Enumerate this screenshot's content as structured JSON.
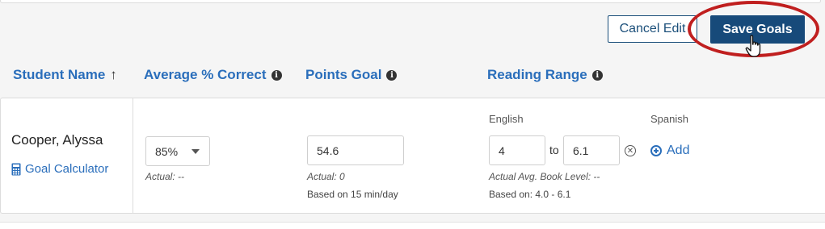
{
  "toolbar": {
    "cancel_label": "Cancel Edit",
    "save_label": "Save Goals"
  },
  "columns": {
    "student_name": "Student Name",
    "avg_correct": "Average % Correct",
    "points_goal": "Points Goal",
    "reading_range": "Reading Range",
    "sort_arrow": "↑",
    "info_glyph": "i"
  },
  "row": {
    "student_name": "Cooper, Alyssa",
    "goal_calculator": "Goal Calculator",
    "avg_correct": {
      "value": "85%",
      "actual": "Actual: --"
    },
    "points_goal": {
      "value": "54.6",
      "actual": "Actual: 0",
      "basis": "Based on 15 min/day"
    },
    "reading_range": {
      "english_label": "English",
      "from": "4",
      "to_label": "to",
      "to": "6.1",
      "clear_glyph": "✕",
      "actual": "Actual Avg. Book Level: --",
      "basis": "Based on: 4.0 - 6.1",
      "spanish_label": "Spanish",
      "add_label": "Add"
    }
  },
  "colors": {
    "accent_blue": "#2a6ebb",
    "primary_button": "#174a7a",
    "highlight_red": "#c01f1f"
  }
}
